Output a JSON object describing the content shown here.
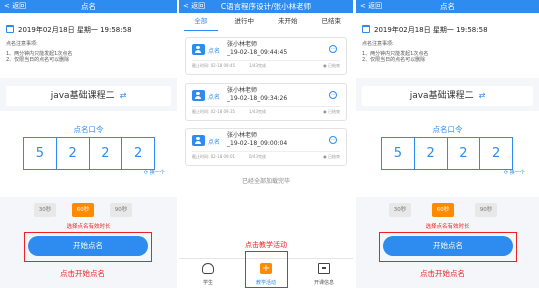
{
  "left_screen": {
    "nav": {
      "back": "< 返回",
      "title": "点名"
    },
    "date": "2019年02月18日 星期一 19:58:58",
    "notes_title": "点名注意事项:",
    "notes": [
      "1、两分钟内只能发起1次点名",
      "2、仅限当日的点名可以删除"
    ],
    "course_name": "java基础课程二",
    "switch_icon": "⇄",
    "code_label": "点名口令",
    "code_digits": [
      "5",
      "2",
      "2",
      "2"
    ],
    "refresh_label": "换一个",
    "timers": [
      "30秒",
      "60秒",
      "90秒"
    ],
    "selected_timer": "60秒",
    "timer_hint": "选择点名有效时长",
    "start_button": "开始点名",
    "annotation": "点击开始点名"
  },
  "middle_screen": {
    "nav": {
      "back": "< 返回",
      "title": "C语言程序设计/张小林老师"
    },
    "tabs": [
      "全部",
      "进行中",
      "未开始",
      "已结束"
    ],
    "active_tab": "全部",
    "records": [
      {
        "tag": "点名",
        "teacher": "张小林老师",
        "time": "_19-02-18_09:44:45",
        "meta": "截止时间: 02-18 09:45",
        "count": "1/43完成",
        "status": "● 已结束"
      },
      {
        "tag": "点名",
        "teacher": "张小林老师",
        "time": "_19-02-18_09:34:26",
        "meta": "截止时间: 02-18 09:35",
        "count": "1/43完成",
        "status": "● 已结束"
      },
      {
        "tag": "点名",
        "teacher": "张小林老师",
        "time": "_19-02-18_09:00:04",
        "meta": "截止时间: 02-18 09:01",
        "count": "0/43完成",
        "status": "● 已结束"
      }
    ],
    "loaded_text": "已经全部加载完毕",
    "annotation": "点击教学活动",
    "bottom_tabs": [
      "学生",
      "教学活动",
      "开课信息"
    ]
  },
  "right_screen": {
    "nav": {
      "back": "< 返回",
      "title": "点名"
    },
    "date": "2019年02月18日 星期一 19:58:58",
    "notes_title": "点名注意事项:",
    "notes": [
      "1、两分钟内只能发起1次点名",
      "2、仅限当日的点名可以删除"
    ],
    "course_name": "java基础课程二",
    "switch_icon": "⇄",
    "code_label": "点名口令",
    "code_digits": [
      "5",
      "2",
      "2",
      "2"
    ],
    "refresh_label": "换一个",
    "timers": [
      "30秒",
      "60秒",
      "90秒"
    ],
    "selected_timer": "60秒",
    "timer_hint": "选择点名有效时长",
    "start_button": "开始点名",
    "annotation": "点击开始点名"
  },
  "colors": {
    "primary": "#2e8cf0",
    "accent": "#ff8a00",
    "annotation": "#e22222"
  }
}
